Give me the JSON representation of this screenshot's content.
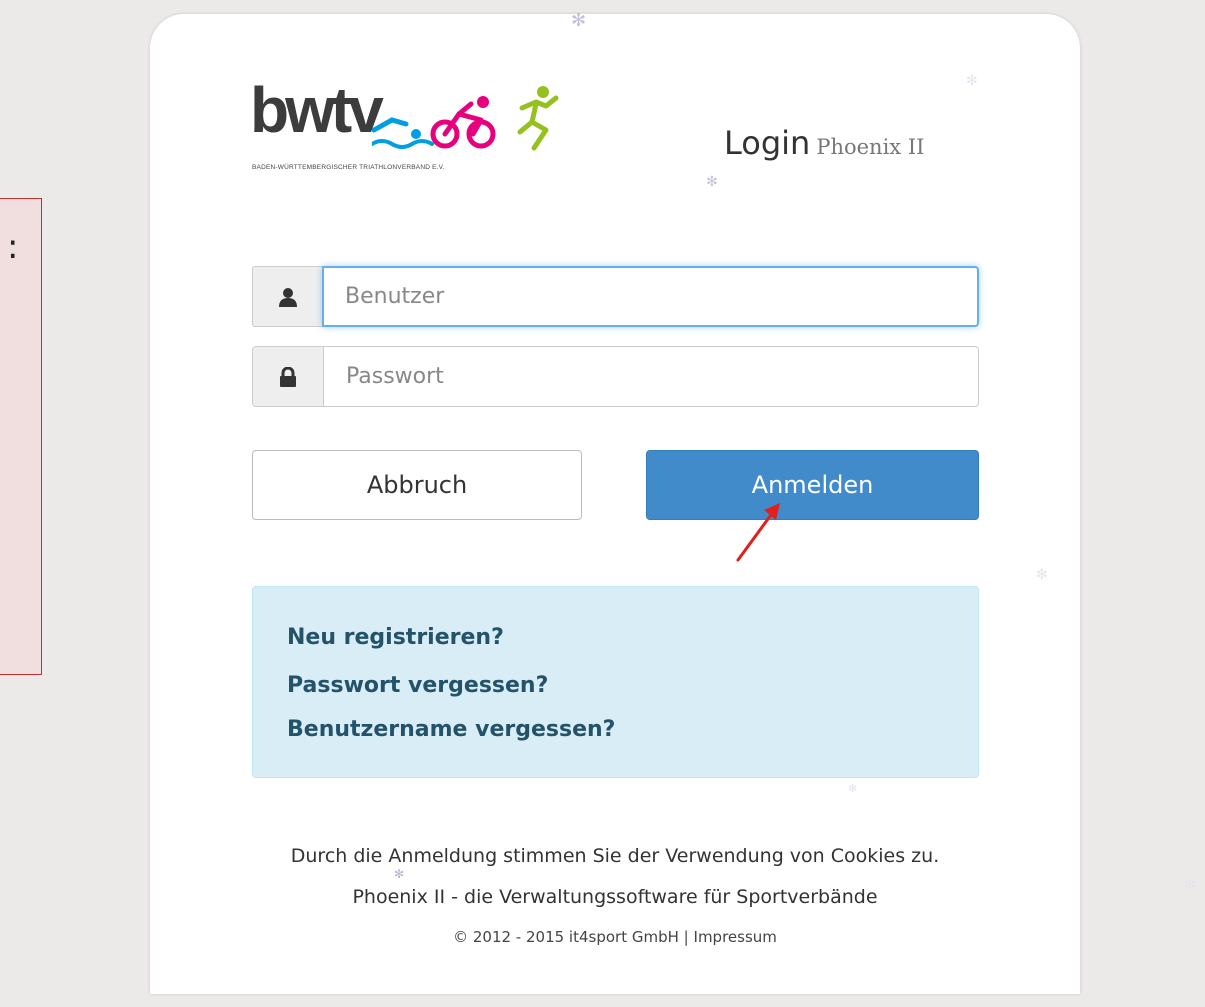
{
  "brand": {
    "logo_text": "bwtv",
    "logo_tagline": "BADEN-WÜRTTEMBERGISCHER TRIATHLONVERBAND E.V."
  },
  "header": {
    "title": "Login",
    "subtitle": "Phoenix II"
  },
  "form": {
    "username_placeholder": "Benutzer",
    "username_value": "",
    "password_placeholder": "Passwort",
    "password_value": ""
  },
  "buttons": {
    "cancel": "Abbruch",
    "login": "Anmelden"
  },
  "links": {
    "register": "Neu registrieren?",
    "forgot_password": "Passwort vergessen?",
    "forgot_username": "Benutzername vergessen?"
  },
  "footer": {
    "cookies": "Durch die Anmeldung stimmen Sie der Verwendung von Cookies zu.",
    "product": "Phoenix II - die Verwaltungssoftware für Sportverbände",
    "copyright": "© 2012 - 2015 it4sport GmbH",
    "separator": "|",
    "imprint": "Impressum"
  },
  "left_panel": {
    "glyph": ":"
  },
  "colors": {
    "primary": "#428bca",
    "info_bg": "#d9edf7",
    "info_text": "#245269",
    "focus": "#66afe9",
    "annotation": "#e0201c",
    "logo_pink": "#e6007e",
    "logo_green": "#95c11f",
    "logo_blue": "#009fe3"
  },
  "icons": {
    "user": "user-icon",
    "lock": "lock-icon",
    "arrow": "red-arrow-annotation",
    "snowflake": "snowflake-icon"
  }
}
